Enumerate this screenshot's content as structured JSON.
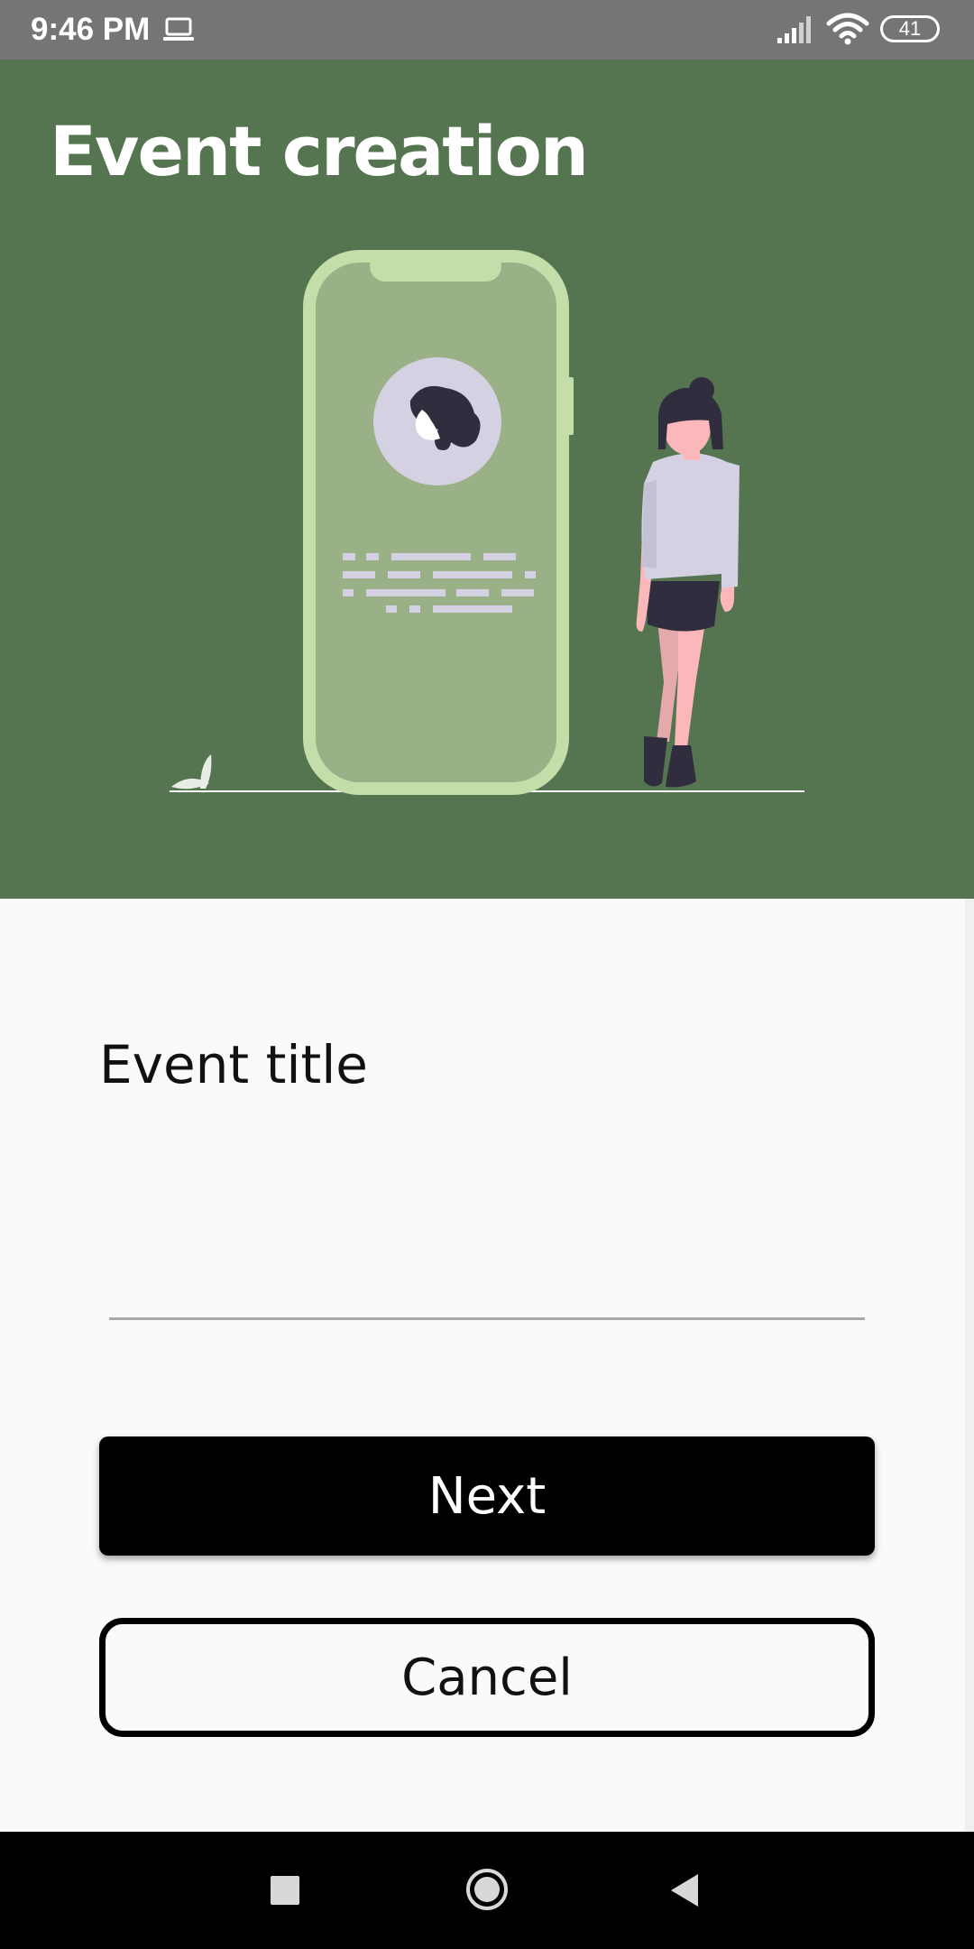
{
  "status_bar": {
    "time": "9:46 PM",
    "battery": "41",
    "icons": [
      "laptop-icon",
      "signal-icon",
      "wifi-icon",
      "battery-icon"
    ]
  },
  "header": {
    "title": "Event creation",
    "background_color": "#557550",
    "illustration": "phone-with-profile-and-woman-illustration"
  },
  "form": {
    "event_title_label": "Event title",
    "event_title_value": "",
    "event_title_placeholder": ""
  },
  "buttons": {
    "next_label": "Next",
    "cancel_label": "Cancel"
  },
  "nav_bar": {
    "icons": [
      "recent-apps-icon",
      "home-icon",
      "back-icon"
    ]
  },
  "colors": {
    "accent": "#557550",
    "phone_fill": "#9ab187",
    "phone_frame": "#c3dea9",
    "primary_button": "#000000"
  }
}
